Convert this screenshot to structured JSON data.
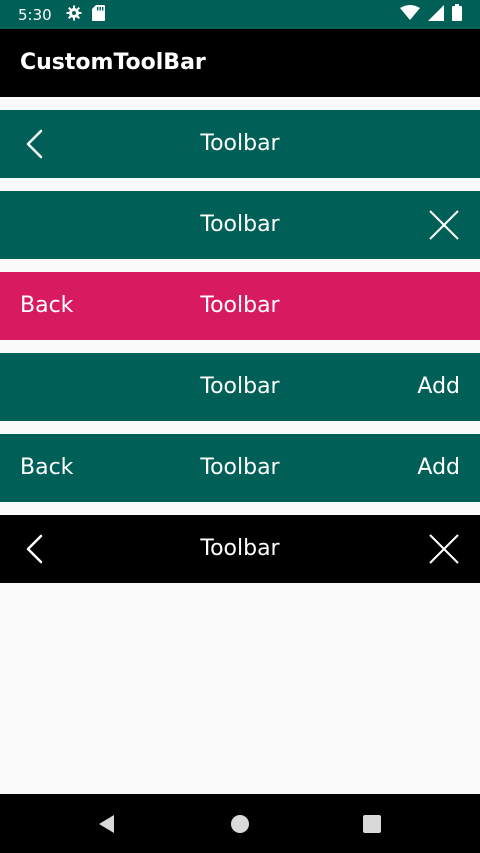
{
  "status_bar": {
    "time": "5:30",
    "background_color": "#005f56",
    "icons_left": [
      "gear-icon",
      "sd-card-icon"
    ],
    "icons_right": [
      "wifi-icon",
      "signal-icon",
      "battery-icon"
    ]
  },
  "app_bar": {
    "title": "CustomToolBar",
    "background_color": "#000000"
  },
  "toolbars": [
    {
      "title": "Toolbar",
      "background_color": "#005f56",
      "left": "back-chevron-icon",
      "right": null
    },
    {
      "title": "Toolbar",
      "background_color": "#005f56",
      "left": null,
      "right": "close-icon"
    },
    {
      "title": "Toolbar",
      "background_color": "#d81b60",
      "left_label": "Back",
      "right": null
    },
    {
      "title": "Toolbar",
      "background_color": "#005f56",
      "left": null,
      "right_label": "Add"
    },
    {
      "title": "Toolbar",
      "background_color": "#005f56",
      "left_label": "Back",
      "right_label": "Add"
    },
    {
      "title": "Toolbar",
      "background_color": "#000000",
      "left": "back-chevron-icon",
      "right": "close-icon"
    }
  ],
  "navigation_bar": {
    "background_color": "#000000",
    "buttons": [
      "back-triangle-icon",
      "home-circle-icon",
      "recents-square-icon"
    ]
  }
}
